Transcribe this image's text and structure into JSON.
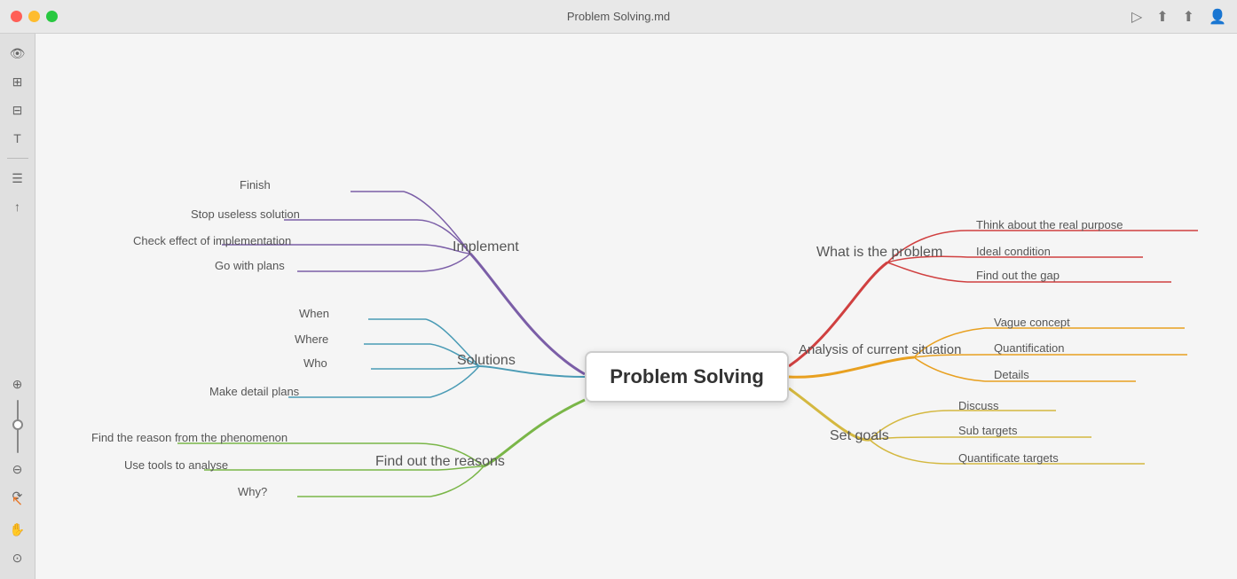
{
  "titlebar": {
    "title": "Problem Solving.md",
    "controls": [
      "play",
      "cloud-upload",
      "share",
      "user"
    ]
  },
  "sidebar": {
    "icons": [
      "eye",
      "diagram",
      "grid",
      "text",
      "menu",
      "upload"
    ],
    "bottom_icons": [
      "cursor",
      "hand",
      "eye"
    ]
  },
  "mindmap": {
    "central_node": "Problem Solving",
    "branches": {
      "implement": {
        "label": "Implement",
        "color": "#7b5ea7",
        "children": [
          "Finish",
          "Stop useless solution",
          "Check effect of implementation",
          "Go with plans"
        ]
      },
      "solutions": {
        "label": "Solutions",
        "color": "#4a9bb5",
        "children": [
          "When",
          "Where",
          "Who",
          "Make detail plans"
        ]
      },
      "find_out_reasons": {
        "label": "Find out the reasons",
        "color": "#7ab648",
        "children": [
          "Find the reason from the phenomenon",
          "Use tools to analyse",
          "Why?"
        ]
      },
      "what_is_problem": {
        "label": "What is the problem",
        "color": "#d04040",
        "children": [
          "Think about the real purpose",
          "Ideal condition",
          "Find out the gap"
        ]
      },
      "analysis": {
        "label": "Analysis of current situation",
        "color": "#e8a020",
        "children": [
          "Vague concept",
          "Quantification",
          "Details"
        ]
      },
      "set_goals": {
        "label": "Set goals",
        "color": "#e8c040",
        "children": [
          "Discuss",
          "Sub targets",
          "Quantificate targets"
        ]
      }
    }
  }
}
